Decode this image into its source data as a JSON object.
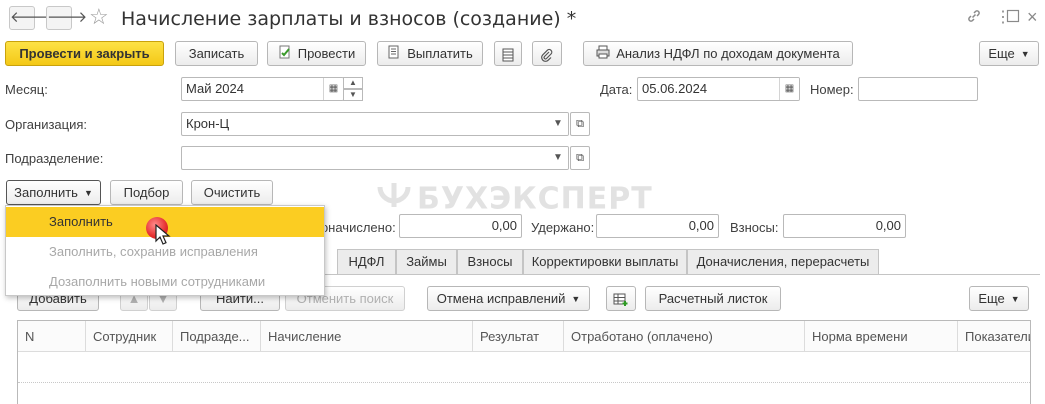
{
  "window": {
    "title": "Начисление зарплаты и взносов (создание) *",
    "back_icon": "arrow-left-icon",
    "forward_icon": "arrow-right-icon",
    "favorite_icon": "star-icon",
    "controls": [
      "link-icon",
      "more-vertical-icon",
      "maximize-icon",
      "close-icon"
    ]
  },
  "toolbar": {
    "post_close": "Провести и закрыть",
    "save": "Записать",
    "post": "Провести",
    "pay": "Выплатить",
    "ndfl_analysis": "Анализ НДФЛ по доходам документа",
    "more": "Еще"
  },
  "form": {
    "month_label": "Месяц:",
    "month_value": "Май 2024",
    "date_label": "Дата:",
    "date_value": "05.06.2024",
    "number_label": "Номер:",
    "number_value": "",
    "org_label": "Организация:",
    "org_value": "Крон-Ц",
    "dept_label": "Подразделение:",
    "dept_value": ""
  },
  "actions": {
    "fill": "Заполнить",
    "pick": "Подбор",
    "clear": "Очистить"
  },
  "fill_menu": [
    {
      "label": "Заполнить",
      "state": "active"
    },
    {
      "label": "Заполнить, сохранив исправления",
      "state": "disabled"
    },
    {
      "label": "Дозаполнить новыми сотрудниками",
      "state": "disabled"
    }
  ],
  "totals": {
    "accrued_label": "Доначислено:",
    "accrued_value": "0,00",
    "withheld_label": "Удержано:",
    "withheld_value": "0,00",
    "contrib_label": "Взносы:",
    "contrib_value": "0,00"
  },
  "watermark": "БУХЭКСПЕРТ",
  "tabs": [
    "НДФЛ",
    "Займы",
    "Взносы",
    "Корректировки выплаты",
    "Доначисления, перерасчеты"
  ],
  "grid_toolbar": {
    "add": "Добавить",
    "find": "Найти...",
    "cancel_search": "Отменить поиск",
    "cancel_corrections": "Отмена исправлений",
    "payslip": "Расчетный листок",
    "more": "Еще"
  },
  "grid": {
    "columns": [
      "N",
      "Сотрудник",
      "Подразде...",
      "Начисление",
      "Результат",
      "Отработано (оплачено)",
      "Норма времени",
      "Показатели"
    ]
  },
  "colors": {
    "primary_button": "#f4c816",
    "menu_highlight": "#fbcd22",
    "cursor_marker": "#e52d2d"
  }
}
